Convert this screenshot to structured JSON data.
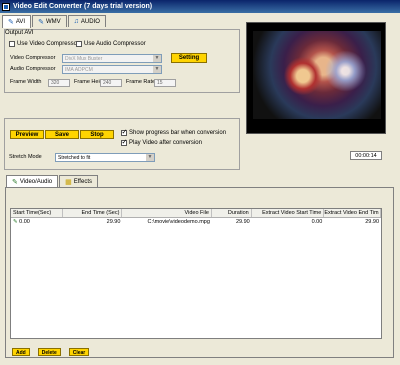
{
  "window": {
    "title": "Video Edit Converter (7 days trial version)"
  },
  "format_tabs": [
    {
      "label": "AVI",
      "icon": "film-icon",
      "active": true
    },
    {
      "label": "WMV",
      "icon": "film-icon",
      "active": false
    },
    {
      "label": "AUDIO",
      "icon": "music-note-icon",
      "active": false
    }
  ],
  "output": {
    "title": "Output AVI",
    "use_video_compressor_label": "Use Video Compressor",
    "use_audio_compressor_label": "Use Audio Compressor",
    "video_compressor_label": "Video Compressor",
    "video_compressor_value": "DivX Mux Buster",
    "audio_compressor_label": "Audio Compressor",
    "audio_compressor_value": "IMA ADPCM",
    "setting_button": "Setting",
    "frame_width_label": "Frame Width",
    "frame_width_value": "320",
    "frame_height_label": "Frame Height",
    "frame_height_value": "240",
    "frame_rate_label": "Frame Rate",
    "frame_rate_value": "15"
  },
  "preview": {
    "time": "00:00:14"
  },
  "controls": {
    "preview_button": "Preview",
    "save_button": "Save",
    "stop_button": "Stop",
    "show_progress_label": "Show progress bar when conversion",
    "play_video_after_label": "Play Video after conversion",
    "stretch_mode_label": "Stretch Mode",
    "stretch_mode_value": "Stretched to fit"
  },
  "content_tabs": [
    {
      "label": "Video/Audio",
      "icon": "video-audio-icon",
      "active": true
    },
    {
      "label": "Effects",
      "icon": "effects-icon",
      "active": false
    }
  ],
  "table": {
    "columns": [
      "Start Time(Sec)",
      "End Time (Sec)",
      "Video File",
      "Duration",
      "Extract Video Start Time",
      "Extract Video End Tim"
    ],
    "rows": [
      [
        "0.00",
        "29.90",
        "C:\\movie\\videodemo.mpg",
        "29.90",
        "0.00",
        "29.90"
      ]
    ]
  },
  "bottom_buttons": {
    "add": "Add",
    "delete": "Delete",
    "clear": "Clear"
  },
  "colors": {
    "title_bar": "#0a246a",
    "accent_button": "#ffd400",
    "background": "#ece9d8"
  }
}
